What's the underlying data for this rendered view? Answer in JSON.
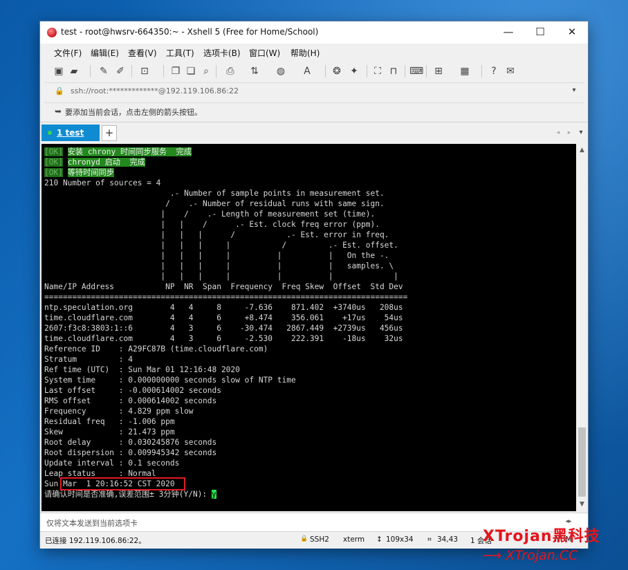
{
  "window": {
    "title": "test - root@hwsrv-664350:~ - Xshell 5 (Free for Home/School)",
    "controls": {
      "minimize": "—",
      "maximize": "☐",
      "close": "✕"
    }
  },
  "menu": [
    "文件(F)",
    "编辑(E)",
    "查看(V)",
    "工具(T)",
    "选项卡(B)",
    "窗口(W)",
    "帮助(H)"
  ],
  "address": {
    "value": "ssh://root:*************@192.119.106.86:22"
  },
  "hint": {
    "text": "要添加当前会话，点击左侧的箭头按钮。"
  },
  "tabs": [
    {
      "number": "1",
      "label": "test",
      "status_color": "#3fd44d"
    }
  ],
  "tab_add": "+",
  "terminal": {
    "ok_lines": [
      {
        "tag": "[OK]",
        "msg": "安装 chrony 时间同步服务  完成"
      },
      {
        "tag": "[OK]",
        "msg": "chronyd 启动  完成"
      },
      {
        "tag": "[OK]",
        "msg": "等待时间同步"
      }
    ],
    "lines": [
      "210 Number of sources = 4",
      "                           .- Number of sample points in measurement set.",
      "                          /    .- Number of residual runs with same sign.",
      "                         |    /    .- Length of measurement set (time).",
      "                         |   |    /      .- Est. clock freq error (ppm).",
      "                         |   |   |      /           .- Est. error in freq.",
      "                         |   |   |     |           /         .- Est. offset.",
      "                         |   |   |     |          |          |   On the -.",
      "                         |   |   |     |          |          |   samples. \\",
      "                         |   |   |     |          |          |             |",
      "Name/IP Address           NP  NR  Span  Frequency  Freq Skew  Offset  Std Dev",
      "==============================================================================",
      "ntp.speculation.org        4   4     8     -7.636    871.402  +3740us   208us",
      "time.cloudflare.com        4   4     6     +8.474    356.061    +17us    54us",
      "2607:f3c8:3803:1::6        4   3     6    -30.474   2867.449  +2739us   456us",
      "time.cloudflare.com        4   3     6     -2.530    222.391    -18us    32us",
      "Reference ID    : A29FC87B (time.cloudflare.com)",
      "Stratum         : 4",
      "Ref time (UTC)  : Sun Mar 01 12:16:48 2020",
      "System time     : 0.000000000 seconds slow of NTP time",
      "Last offset     : -0.000614002 seconds",
      "RMS offset      : 0.000614002 seconds",
      "Frequency       : 4.829 ppm slow",
      "Residual freq   : -1.006 ppm",
      "Skew            : 21.473 ppm",
      "Root delay      : 0.030245876 seconds",
      "Root dispersion : 0.009945342 seconds",
      "Update interval : 0.1 seconds",
      "Leap status     : Normal",
      "Sun Mar  1 20:16:52 CST 2020"
    ],
    "prompt": "请确认时间是否准确,误差范围± 3分钟(Y/N): ",
    "input": "y"
  },
  "send_bar": {
    "placeholder": "仅将文本发送到当前选项卡"
  },
  "status": {
    "connection": "已连接 192.119.106.86:22。",
    "protocol": "SSH2",
    "term": "xterm",
    "size": "109x34",
    "cursor": "34,43",
    "sessions": "1 会话",
    "numlock": "NUM"
  },
  "watermark": {
    "brand": "XTrojan黑科技",
    "url": "XTrojan.CC"
  },
  "colors": {
    "tab_active": "#0f8bd2",
    "ok_bg": "#1f6e1a",
    "ok_msg_bg": "#23881e",
    "cursor": "#29e34a",
    "highlight": "#e01c24",
    "watermark": "#e5141c"
  }
}
